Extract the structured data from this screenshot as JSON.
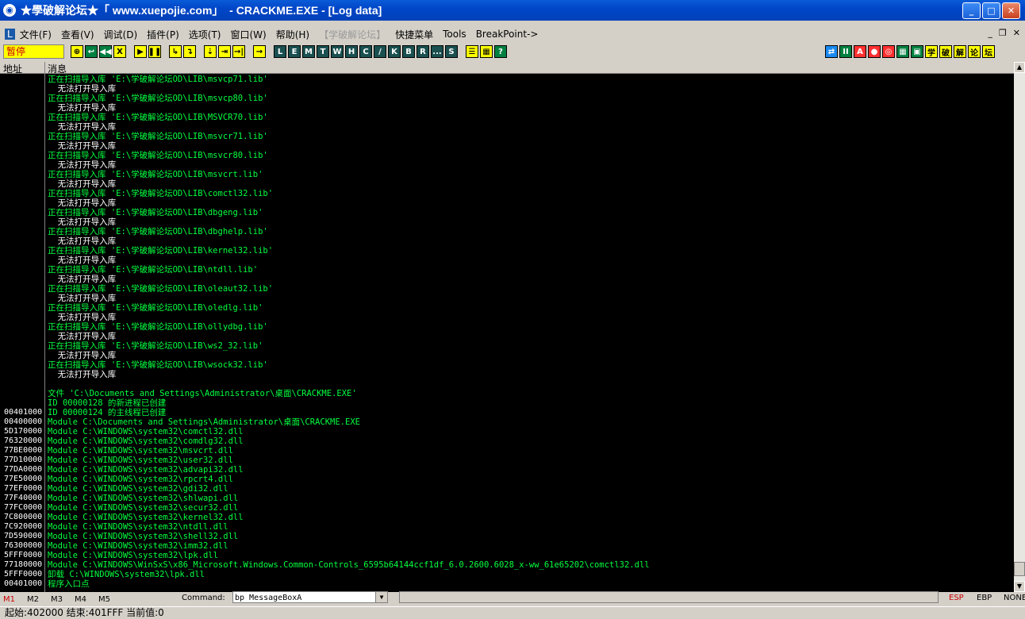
{
  "window": {
    "title": "★學破解论坛★「 www.xuepojie.com」  - CRACKME.EXE - [Log data]"
  },
  "menu": {
    "items": [
      "文件(F)",
      "查看(V)",
      "调试(D)",
      "插件(P)",
      "选项(T)",
      "窗口(W)",
      "帮助(H)",
      "【学破解论坛】",
      "快捷菜单",
      "Tools",
      "BreakPoint->"
    ]
  },
  "toolbar": {
    "status": "暂停",
    "buttons_a": [
      "⊕",
      "↩",
      "◀◀",
      "X"
    ],
    "buttons_b": [
      "▶",
      "❚❚"
    ],
    "buttons_c": [
      "↳",
      "↴",
      "⇣",
      "⇥",
      "→|"
    ],
    "letters": [
      "L",
      "E",
      "M",
      "T",
      "W",
      "H",
      "C",
      "/",
      "K",
      "B",
      "R",
      "...",
      "S"
    ],
    "right_buttons": [
      "⇄",
      "II",
      "A",
      "●",
      "◎",
      "▦",
      "▣"
    ],
    "right_chars": [
      "学",
      "破",
      "解",
      "论",
      "坛"
    ]
  },
  "columns": {
    "addr": "地址",
    "msg": "消息"
  },
  "log": [
    {
      "addr": "",
      "msg": "正在扫描导入库 'E:\\学破解论坛OD\\LIB\\msvcp71.lib'",
      "c": "green"
    },
    {
      "addr": "",
      "msg": "  无法打开导入库",
      "c": "white"
    },
    {
      "addr": "",
      "msg": "正在扫描导入库 'E:\\学破解论坛OD\\LIB\\msvcp80.lib'",
      "c": "green"
    },
    {
      "addr": "",
      "msg": "  无法打开导入库",
      "c": "white"
    },
    {
      "addr": "",
      "msg": "正在扫描导入库 'E:\\学破解论坛OD\\LIB\\MSVCR70.lib'",
      "c": "green"
    },
    {
      "addr": "",
      "msg": "  无法打开导入库",
      "c": "white"
    },
    {
      "addr": "",
      "msg": "正在扫描导入库 'E:\\学破解论坛OD\\LIB\\msvcr71.lib'",
      "c": "green"
    },
    {
      "addr": "",
      "msg": "  无法打开导入库",
      "c": "white"
    },
    {
      "addr": "",
      "msg": "正在扫描导入库 'E:\\学破解论坛OD\\LIB\\msvcr80.lib'",
      "c": "green"
    },
    {
      "addr": "",
      "msg": "  无法打开导入库",
      "c": "white"
    },
    {
      "addr": "",
      "msg": "正在扫描导入库 'E:\\学破解论坛OD\\LIB\\msvcrt.lib'",
      "c": "green"
    },
    {
      "addr": "",
      "msg": "  无法打开导入库",
      "c": "white"
    },
    {
      "addr": "",
      "msg": "正在扫描导入库 'E:\\学破解论坛OD\\LIB\\comctl32.lib'",
      "c": "green"
    },
    {
      "addr": "",
      "msg": "  无法打开导入库",
      "c": "white"
    },
    {
      "addr": "",
      "msg": "正在扫描导入库 'E:\\学破解论坛OD\\LIB\\dbgeng.lib'",
      "c": "green"
    },
    {
      "addr": "",
      "msg": "  无法打开导入库",
      "c": "white"
    },
    {
      "addr": "",
      "msg": "正在扫描导入库 'E:\\学破解论坛OD\\LIB\\dbghelp.lib'",
      "c": "green"
    },
    {
      "addr": "",
      "msg": "  无法打开导入库",
      "c": "white"
    },
    {
      "addr": "",
      "msg": "正在扫描导入库 'E:\\学破解论坛OD\\LIB\\kernel32.lib'",
      "c": "green"
    },
    {
      "addr": "",
      "msg": "  无法打开导入库",
      "c": "white"
    },
    {
      "addr": "",
      "msg": "正在扫描导入库 'E:\\学破解论坛OD\\LIB\\ntdll.lib'",
      "c": "green"
    },
    {
      "addr": "",
      "msg": "  无法打开导入库",
      "c": "white"
    },
    {
      "addr": "",
      "msg": "正在扫描导入库 'E:\\学破解论坛OD\\LIB\\oleaut32.lib'",
      "c": "green"
    },
    {
      "addr": "",
      "msg": "  无法打开导入库",
      "c": "white"
    },
    {
      "addr": "",
      "msg": "正在扫描导入库 'E:\\学破解论坛OD\\LIB\\oledlg.lib'",
      "c": "green"
    },
    {
      "addr": "",
      "msg": "  无法打开导入库",
      "c": "white"
    },
    {
      "addr": "",
      "msg": "正在扫描导入库 'E:\\学破解论坛OD\\LIB\\ollydbg.lib'",
      "c": "green"
    },
    {
      "addr": "",
      "msg": "  无法打开导入库",
      "c": "white"
    },
    {
      "addr": "",
      "msg": "正在扫描导入库 'E:\\学破解论坛OD\\LIB\\ws2_32.lib'",
      "c": "green"
    },
    {
      "addr": "",
      "msg": "  无法打开导入库",
      "c": "white"
    },
    {
      "addr": "",
      "msg": "正在扫描导入库 'E:\\学破解论坛OD\\LIB\\wsock32.lib'",
      "c": "green"
    },
    {
      "addr": "",
      "msg": "  无法打开导入库",
      "c": "white"
    },
    {
      "addr": "",
      "msg": "",
      "c": "green"
    },
    {
      "addr": "",
      "msg": "文件 'C:\\Documents and Settings\\Administrator\\桌面\\CRACKME.EXE'",
      "c": "green"
    },
    {
      "addr": "",
      "msg": "ID 00000128 的新进程已创建",
      "c": "green"
    },
    {
      "addr": "00401000",
      "msg": "ID 00000124 的主线程已创建",
      "c": "green"
    },
    {
      "addr": "00400000",
      "msg": "Module C:\\Documents and Settings\\Administrator\\桌面\\CRACKME.EXE",
      "c": "green"
    },
    {
      "addr": "5D170000",
      "msg": "Module C:\\WINDOWS\\system32\\comctl32.dll",
      "c": "green"
    },
    {
      "addr": "76320000",
      "msg": "Module C:\\WINDOWS\\system32\\comdlg32.dll",
      "c": "green"
    },
    {
      "addr": "77BE0000",
      "msg": "Module C:\\WINDOWS\\system32\\msvcrt.dll",
      "c": "green"
    },
    {
      "addr": "77D10000",
      "msg": "Module C:\\WINDOWS\\system32\\user32.dll",
      "c": "green"
    },
    {
      "addr": "77DA0000",
      "msg": "Module C:\\WINDOWS\\system32\\advapi32.dll",
      "c": "green"
    },
    {
      "addr": "77E50000",
      "msg": "Module C:\\WINDOWS\\system32\\rpcrt4.dll",
      "c": "green"
    },
    {
      "addr": "77EF0000",
      "msg": "Module C:\\WINDOWS\\system32\\gdi32.dll",
      "c": "green"
    },
    {
      "addr": "77F40000",
      "msg": "Module C:\\WINDOWS\\system32\\shlwapi.dll",
      "c": "green"
    },
    {
      "addr": "77FC0000",
      "msg": "Module C:\\WINDOWS\\system32\\secur32.dll",
      "c": "green"
    },
    {
      "addr": "7C800000",
      "msg": "Module C:\\WINDOWS\\system32\\kernel32.dll",
      "c": "green"
    },
    {
      "addr": "7C920000",
      "msg": "Module C:\\WINDOWS\\system32\\ntdll.dll",
      "c": "green"
    },
    {
      "addr": "7D590000",
      "msg": "Module C:\\WINDOWS\\system32\\shell32.dll",
      "c": "green"
    },
    {
      "addr": "76300000",
      "msg": "Module C:\\WINDOWS\\system32\\imm32.dll",
      "c": "green"
    },
    {
      "addr": "5FFF0000",
      "msg": "Module C:\\WINDOWS\\system32\\lpk.dll",
      "c": "green"
    },
    {
      "addr": "77180000",
      "msg": "Module C:\\WINDOWS\\WinSxS\\x86_Microsoft.Windows.Common-Controls_6595b64144ccf1df_6.0.2600.6028_x-ww_61e65202\\comctl32.dll",
      "c": "green"
    },
    {
      "addr": "5FFF0000",
      "msg": "卸载 C:\\WINDOWS\\system32\\lpk.dll",
      "c": "green"
    },
    {
      "addr": "00401000",
      "msg": "程序入口点",
      "c": "green"
    }
  ],
  "bottom": {
    "tabs": [
      "M1",
      "M2",
      "M3",
      "M4",
      "M5"
    ],
    "command_label": "Command:",
    "command_value": "bp MessageBoxA",
    "regs": [
      "ESP",
      "EBP",
      "NONE"
    ]
  },
  "statusbar": {
    "text": "起始:402000 结束:401FFF 当前值:0"
  }
}
